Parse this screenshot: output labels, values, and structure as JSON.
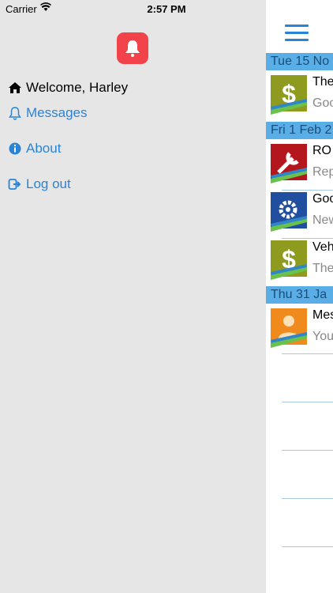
{
  "status": {
    "carrier": "Carrier",
    "time": "2:57 PM"
  },
  "menu": {
    "welcome": "Welcome, Harley",
    "messages": "Messages",
    "about": "About",
    "logout": "Log out"
  },
  "feed": {
    "dates": [
      "Tue 15 No",
      "Fri 1 Feb 2",
      "Thu 31 Ja"
    ],
    "items": [
      {
        "title": "The",
        "subtitle": "Goo",
        "icon": "dollar-icon"
      },
      {
        "title": "RO",
        "subtitle": "Rep",
        "icon": "wrench-icon"
      },
      {
        "title": "Goo",
        "subtitle": "New",
        "icon": "gear-icon"
      },
      {
        "title": "Veh",
        "subtitle": "The",
        "icon": "dollar-icon"
      },
      {
        "title": "Mes",
        "subtitle": "You",
        "icon": "person-icon"
      }
    ]
  },
  "colors": {
    "accent": "#2a84d6",
    "app_icon": "#f2434a",
    "date_header": "#5aaee8"
  }
}
